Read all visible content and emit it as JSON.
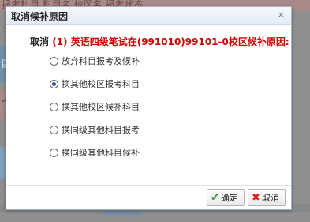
{
  "background": {
    "topbar_text": "报考科目 科目名  校区名 报考状态",
    "tab_text": "目",
    "strip_text": "门"
  },
  "dialog": {
    "title": "取消候补原因",
    "close_symbol": "×",
    "prompt": {
      "prefix": "取消",
      "course": "(1) 英语四级笔试",
      "middle": "在",
      "code": "(991010)99101-0校区",
      "suffix": "候补原因:"
    },
    "options": [
      {
        "label": "放弃科目报考及候补",
        "checked": false
      },
      {
        "label": "换其他校区报考科目",
        "checked": true
      },
      {
        "label": "换其他校区候补科目",
        "checked": false
      },
      {
        "label": "换同级其他科目报考",
        "checked": false
      },
      {
        "label": "换同级其他科目候补",
        "checked": false
      }
    ],
    "buttons": {
      "ok_label": "确定",
      "cancel_label": "取消"
    }
  },
  "colors": {
    "accent_red": "#d40000",
    "radio_selected": "#2f5b9a",
    "ok_icon": "#2f8f2f",
    "cancel_icon": "#d62020"
  },
  "icons": [
    "close-icon",
    "check-icon",
    "cross-icon"
  ]
}
